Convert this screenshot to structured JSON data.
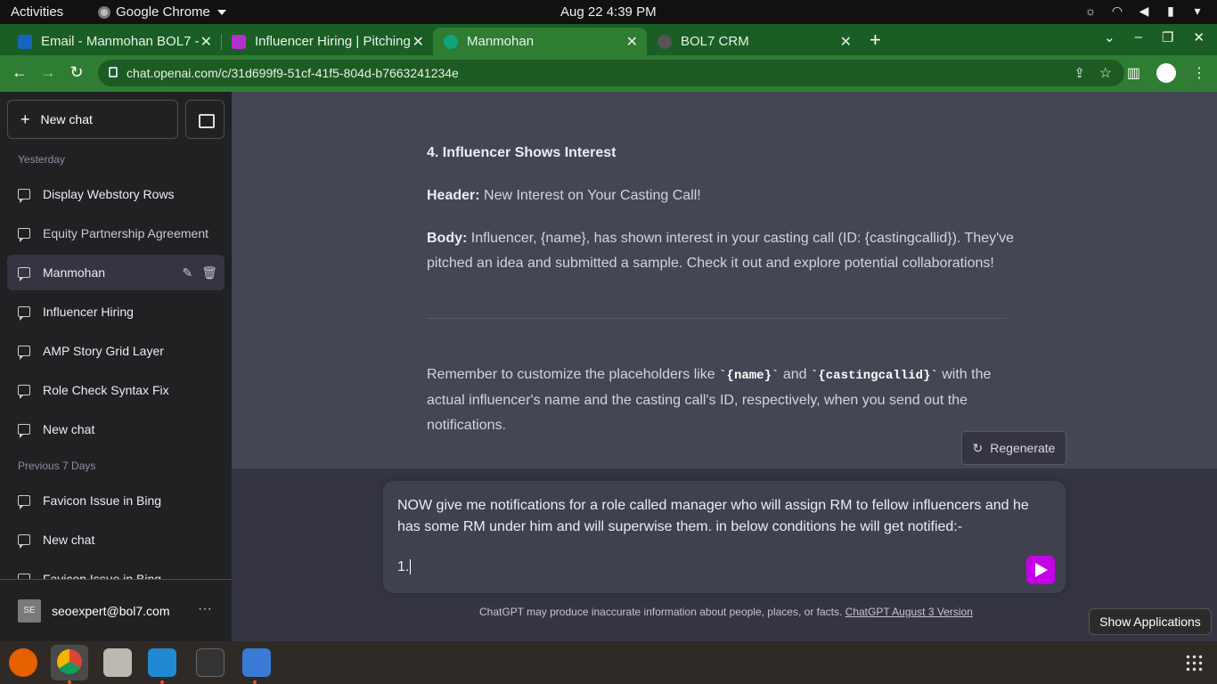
{
  "topbar": {
    "activities": "Activities",
    "app_name": "Google Chrome",
    "clock": "Aug 22  4:39 PM"
  },
  "tabs": [
    {
      "title": "Email - Manmohan BOL7 -",
      "active": false
    },
    {
      "title": "Influencer Hiring | Pitching",
      "active": false
    },
    {
      "title": "Manmohan",
      "active": true
    },
    {
      "title": "BOL7 CRM",
      "active": false
    }
  ],
  "address_bar": {
    "url": "chat.openai.com/c/31d699f9-51cf-41f5-804d-b7663241234e"
  },
  "sidebar": {
    "new_chat": "New chat",
    "group_yesterday": "Yesterday",
    "group_prev7": "Previous 7 Days",
    "items": [
      {
        "label": "Display Webstory Rows"
      },
      {
        "label": "Equity Partnership Agreement"
      },
      {
        "label": "Manmohan"
      },
      {
        "label": "Influencer Hiring"
      },
      {
        "label": "AMP Story Grid Layer"
      },
      {
        "label": "Role Check Syntax Fix"
      },
      {
        "label": "New chat"
      },
      {
        "label": "Favicon Issue in Bing"
      },
      {
        "label": "New chat"
      },
      {
        "label": "Favicon Issue in Bing"
      }
    ],
    "user_initials": "SE",
    "user_email": "seoexpert@bol7.com",
    "more": "···"
  },
  "message": {
    "heading": "4. Influencer Shows Interest",
    "header_label": "Header:",
    "header_text": " New Interest on Your Casting Call!",
    "body_label": "Body:",
    "body_text": " Influencer, {name}, has shown interest in your casting call (ID: {castingcallid}). They've pitched an idea and submitted a sample. Check it out and explore potential collaborations!",
    "remember_1": "Remember to customize the placeholders like ",
    "code_name": "`{name}`",
    "remember_2": " and ",
    "code_cast": "`{castingcallid}`",
    "remember_3": " with the actual influencer's name and the casting call's ID, respectively, when you send out the notifications."
  },
  "regenerate": "Regenerate",
  "composer": {
    "text": "NOW give me notifications for a role called manager who will assign RM to fellow influencers and he has some RM under him and will superwise them. in below conditions he will get notified:-",
    "line2": "1."
  },
  "disclaimer": {
    "text": "ChatGPT may produce inaccurate information about people, places, or facts. ",
    "link": "ChatGPT August 3 Version"
  },
  "tooltip": "Show Applications",
  "colors": {
    "tab_strip": "#1a5e25",
    "toolbar": "#2e7d32",
    "send_button": "#c400e6"
  }
}
